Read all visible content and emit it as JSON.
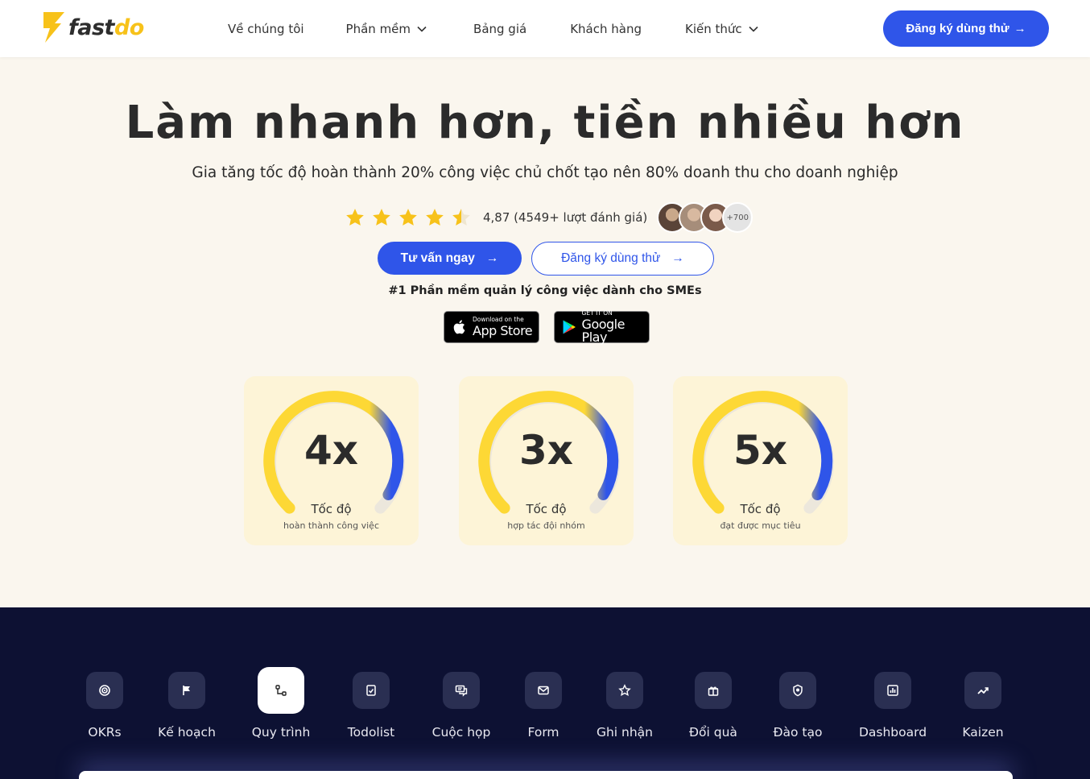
{
  "header": {
    "logo": {
      "part1": "fast",
      "part2": "do"
    },
    "nav": [
      {
        "label": "Về chúng tôi",
        "dropdown": false
      },
      {
        "label": "Phần mềm",
        "dropdown": true
      },
      {
        "label": "Bảng giá",
        "dropdown": false
      },
      {
        "label": "Khách hàng",
        "dropdown": false
      },
      {
        "label": "Kiến thức",
        "dropdown": true
      }
    ],
    "cta_label": "Đăng ký dùng thử",
    "cta_arrow": "→"
  },
  "hero": {
    "title": "Làm nhanh hơn, tiền nhiều hơn",
    "subtitle": "Gia tăng tốc độ hoàn thành 20% công việc chủ chốt tạo nên 80% doanh thu cho doanh nghiệp",
    "rating": {
      "stars_value": 4.5,
      "text": "4,87 (4549+ lượt đánh giá)",
      "more_users": "+700"
    },
    "primary_button": "Tư vấn ngay",
    "secondary_button": "Đăng ký dùng thử",
    "arrow": "→",
    "tagline": "#1 Phần mềm quản lý công việc dành cho SMEs",
    "app_store": {
      "small": "Download on the",
      "big": "App Store"
    },
    "google_play": {
      "small": "GET IT ON",
      "big": "Google Play"
    }
  },
  "gauges": [
    {
      "value": "4x",
      "label": "Tốc độ",
      "caption": "hoàn thành công việc"
    },
    {
      "value": "3x",
      "label": "Tốc độ",
      "caption": "hợp tác đội nhóm"
    },
    {
      "value": "5x",
      "label": "Tốc độ",
      "caption": "đạt được mục tiêu"
    }
  ],
  "colors": {
    "brand_blue": "#2f55e9",
    "brand_yellow": "#f7c21a",
    "gauge_yellow": "#fdd835",
    "dark_bg": "#0d1133"
  },
  "features": [
    {
      "label": "OKRs",
      "icon": "target-icon",
      "active": false
    },
    {
      "label": "Kế hoạch",
      "icon": "flag-icon",
      "active": false
    },
    {
      "label": "Quy trình",
      "icon": "workflow-icon",
      "active": true
    },
    {
      "label": "Todolist",
      "icon": "checklist-icon",
      "active": false
    },
    {
      "label": "Cuộc họp",
      "icon": "chat-icon",
      "active": false
    },
    {
      "label": "Form",
      "icon": "mail-icon",
      "active": false
    },
    {
      "label": "Ghi nhận",
      "icon": "star-icon",
      "active": false
    },
    {
      "label": "Đổi quà",
      "icon": "gift-icon",
      "active": false
    },
    {
      "label": "Đào tạo",
      "icon": "badge-icon",
      "active": false
    },
    {
      "label": "Dashboard",
      "icon": "chart-icon",
      "active": false
    },
    {
      "label": "Kaizen",
      "icon": "trend-icon",
      "active": false
    }
  ]
}
